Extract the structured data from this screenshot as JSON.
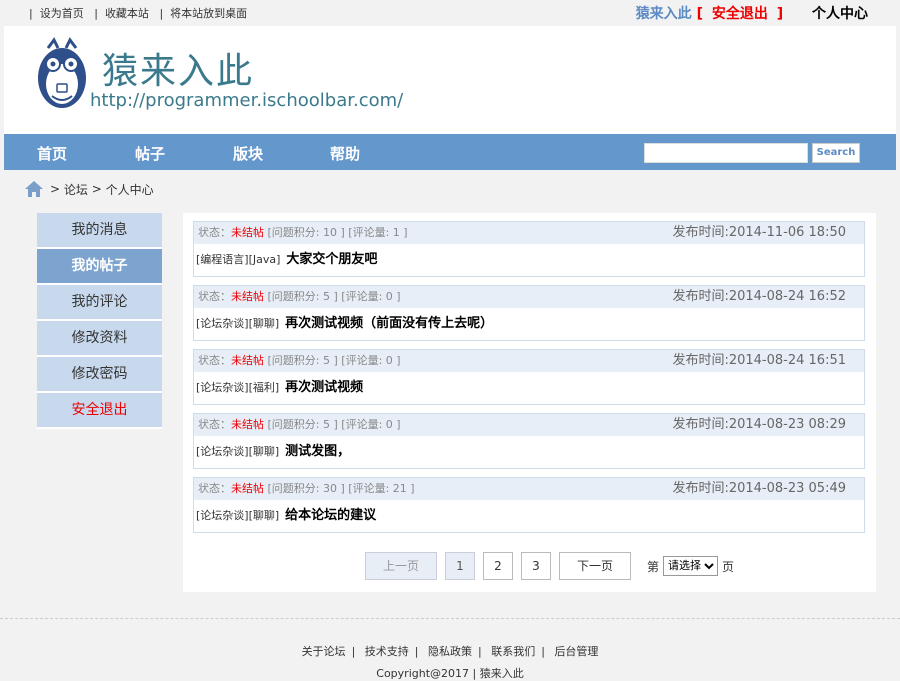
{
  "topbar": {
    "links": [
      "设为首页",
      "收藏本站",
      "将本站放到桌面"
    ],
    "username": "猿来入此",
    "logout": "安全退出",
    "bracket_open": "[",
    "bracket_close": "]",
    "user_center": "个人中心"
  },
  "header": {
    "title": "猿来入此",
    "url": "http://programmer.ischoolbar.com/"
  },
  "nav": {
    "items": [
      "首页",
      "帖子",
      "版块",
      "帮助"
    ],
    "search_placeholder": "",
    "search_button": "Search"
  },
  "breadcrumb": {
    "sep": ">",
    "forum": "论坛",
    "current": "个人中心"
  },
  "sidebar": {
    "items": [
      "我的消息",
      "我的帖子",
      "我的评论",
      "修改资料",
      "修改密码",
      "安全退出"
    ]
  },
  "posts": [
    {
      "status_label": "状态：",
      "status": "未结帖",
      "score": "[问题积分: 10 ]",
      "comments": "[评论量: 1 ]",
      "time": "发布时间:2014-11-06 18:50",
      "category": "[编程语言][Java]",
      "title": "大家交个朋友吧"
    },
    {
      "status_label": "状态：",
      "status": "未结帖",
      "score": "[问题积分: 5 ]",
      "comments": "[评论量: 0 ]",
      "time": "发布时间:2014-08-24 16:52",
      "category": "[论坛杂谈][聊聊]",
      "title": "再次测试视频（前面没有传上去呢）"
    },
    {
      "status_label": "状态：",
      "status": "未结帖",
      "score": "[问题积分: 5 ]",
      "comments": "[评论量: 0 ]",
      "time": "发布时间:2014-08-24 16:51",
      "category": "[论坛杂谈][福利]",
      "title": "再次测试视频"
    },
    {
      "status_label": "状态：",
      "status": "未结帖",
      "score": "[问题积分: 5 ]",
      "comments": "[评论量: 0 ]",
      "time": "发布时间:2014-08-23 08:29",
      "category": "[论坛杂谈][聊聊]",
      "title": "测试发图，"
    },
    {
      "status_label": "状态：",
      "status": "未结帖",
      "score": "[问题积分: 30 ]",
      "comments": "[评论量: 21 ]",
      "time": "发布时间:2014-08-23 05:49",
      "category": "[论坛杂谈][聊聊]",
      "title": "给本论坛的建议"
    }
  ],
  "pager": {
    "prev": "上一页",
    "pages": [
      "1",
      "2",
      "3"
    ],
    "next": "下一页",
    "di": "第",
    "select_value": "请选择",
    "ye": "页"
  },
  "footer": {
    "links": [
      "关于论坛",
      "技术支持",
      "隐私政策",
      "联系我们",
      "后台管理"
    ],
    "copyright": "Copyright@2017 | 猿来入此"
  },
  "colors": {
    "nav": "#6497cc",
    "accent": "#3a7a8c",
    "danger": "#e00000"
  }
}
